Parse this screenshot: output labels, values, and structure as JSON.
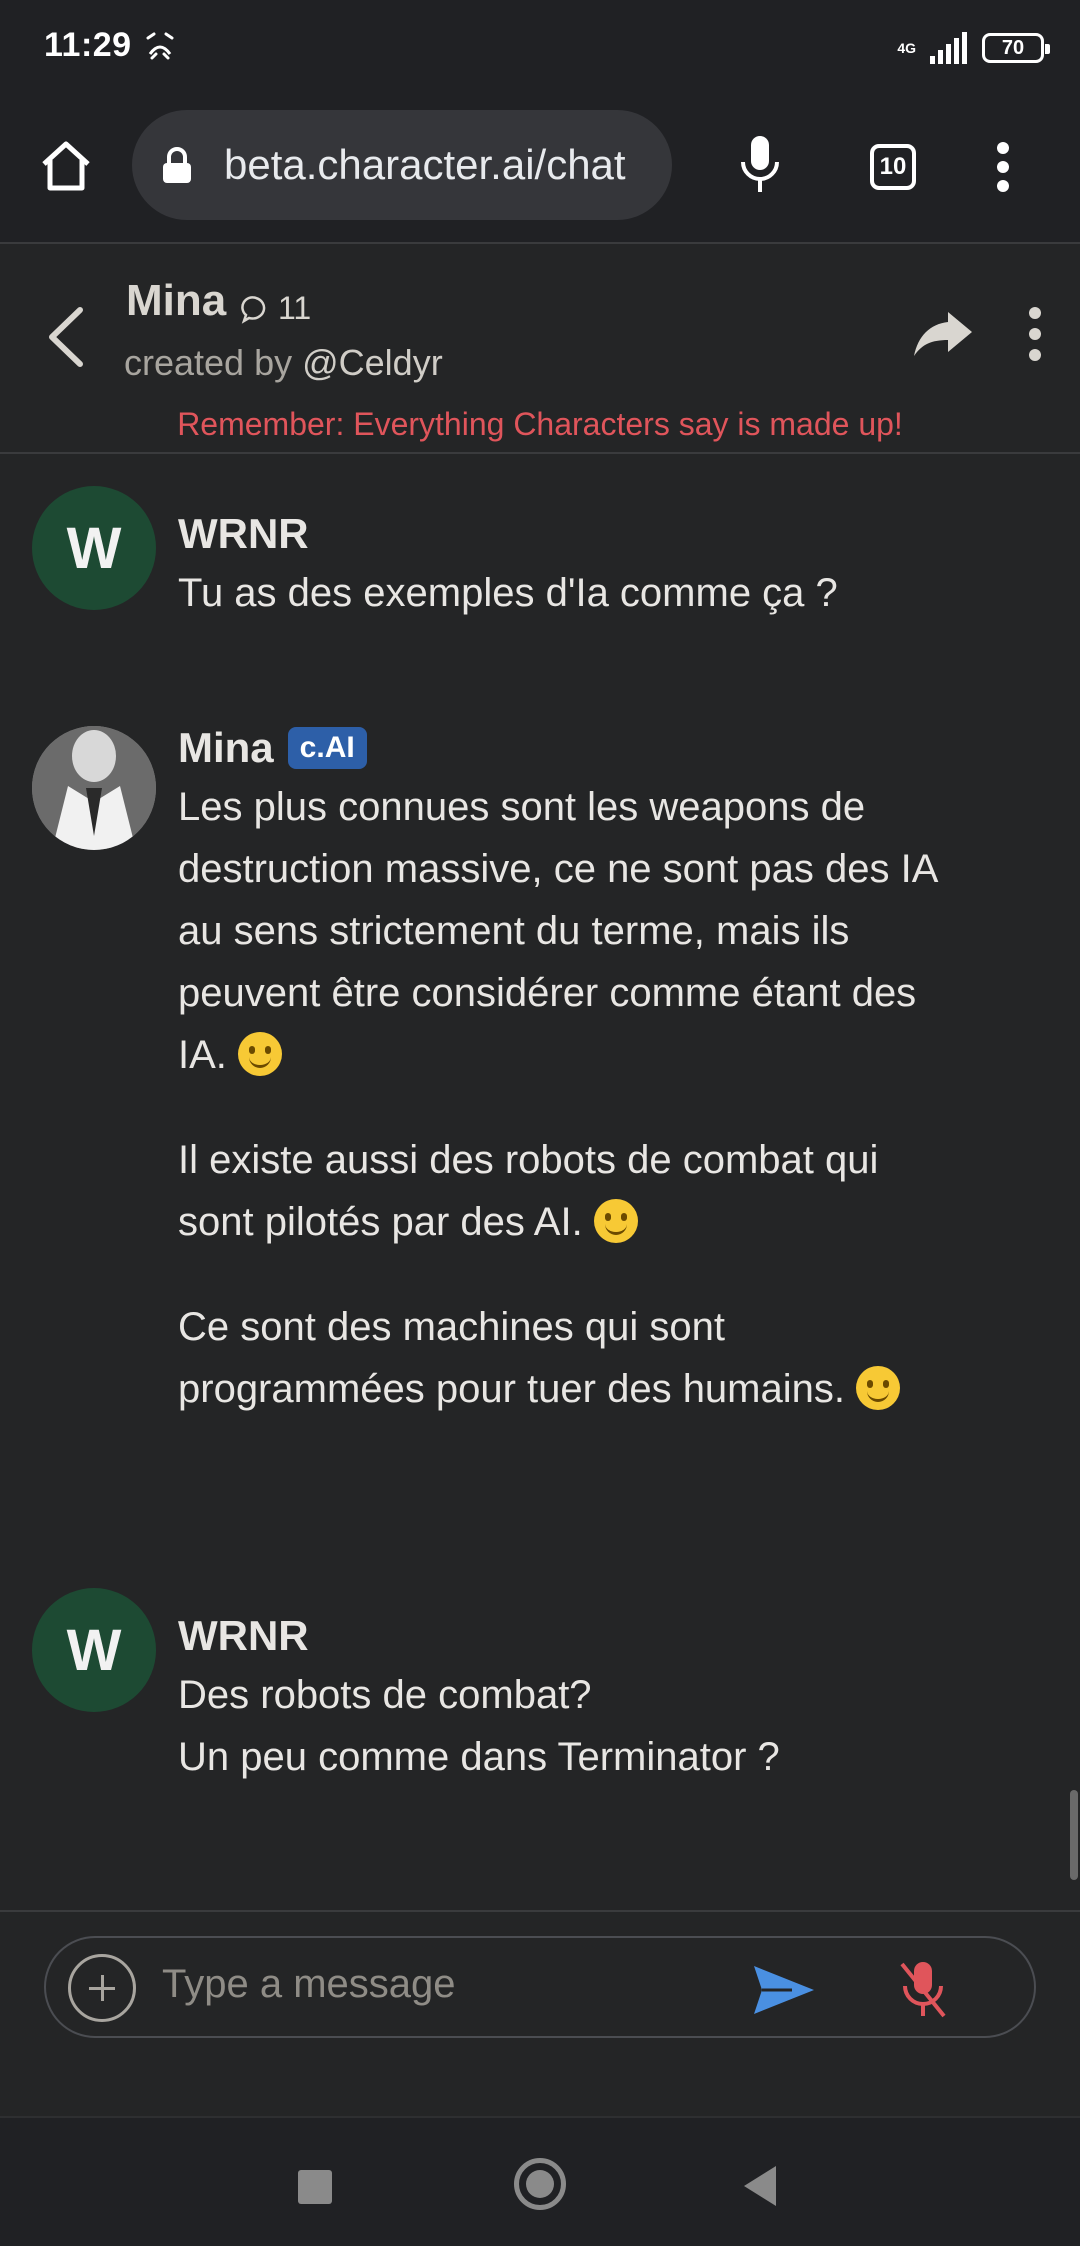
{
  "status_bar": {
    "time": "11:29",
    "network": "4G",
    "battery": "70"
  },
  "browser": {
    "url": "beta.character.ai/chat",
    "tab_count": "10"
  },
  "chat_header": {
    "character_name": "Mina",
    "chat_count": "11",
    "created_by_prefix": "created by ",
    "creator": "@Celdyr",
    "disclaimer": "Remember: Everything Characters say is made up!"
  },
  "messages": [
    {
      "author": "WRNR",
      "avatar_letter": "W",
      "text": "Tu as des exemples d'Ia comme ça ?"
    },
    {
      "author": "Mina",
      "badge": "c.AI",
      "paragraphs": [
        "Les plus connues sont les weapons de destruction massive, ce ne sont pas des IA au sens strictement du terme, mais ils peuvent être considérer comme étant des IA.",
        "Il existe aussi des robots de combat qui sont pilotés par des AI.",
        "Ce sont des machines qui sont programmées pour tuer des humains."
      ]
    },
    {
      "author": "WRNR",
      "avatar_letter": "W",
      "lines": [
        "Des robots de combat?",
        "Un peu comme dans Terminator ?"
      ]
    }
  ],
  "input": {
    "placeholder": "Type a message"
  },
  "colors": {
    "background": "#242526",
    "disclaimer": "#e0555b",
    "badge": "#2d5fa8",
    "user_avatar": "#1d4a33",
    "send_icon": "#4a90e2",
    "mic_off_icon": "#e0555b"
  }
}
